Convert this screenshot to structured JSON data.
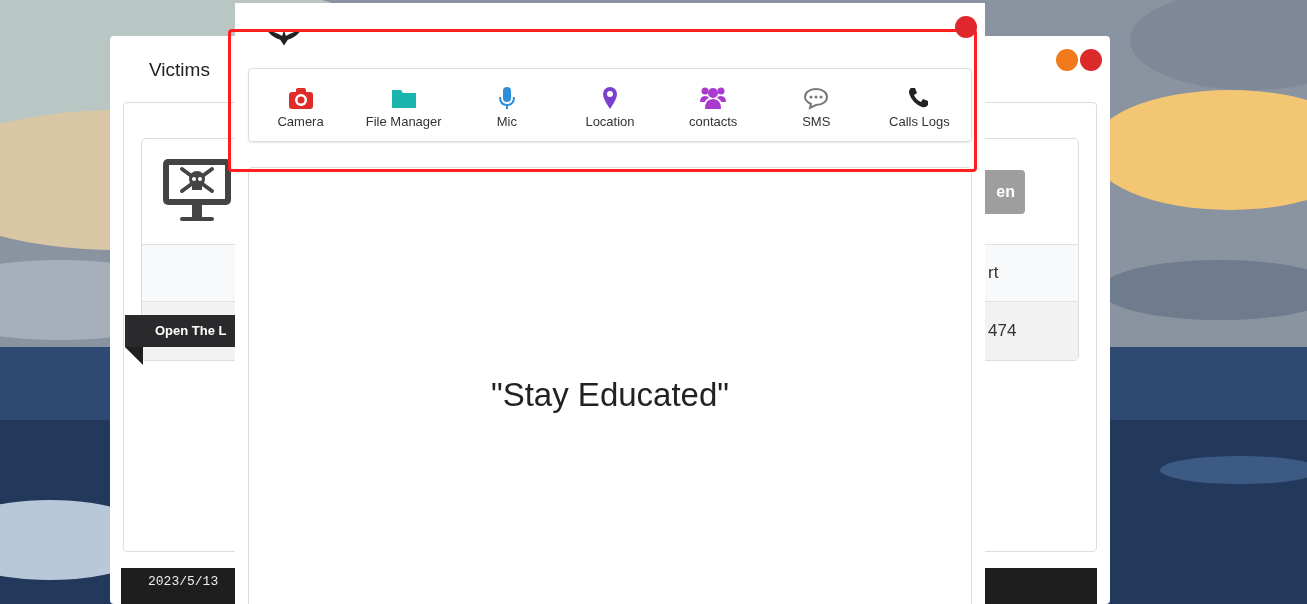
{
  "back_window": {
    "title": "Victims",
    "victim_card": {
      "button": "en",
      "table": {
        "header": "rt",
        "row": "474"
      },
      "ribbon": "Open The L"
    },
    "log_bar": [
      "2023/5/13"
    ]
  },
  "modal": {
    "toolbar": [
      {
        "kind": "camera",
        "label": "Camera",
        "color": "#e02b2b"
      },
      {
        "kind": "folder",
        "label": "File Manager",
        "color": "#1bb5ad"
      },
      {
        "kind": "mic",
        "label": "Mic",
        "color": "#2d8fd9"
      },
      {
        "kind": "pin",
        "label": "Location",
        "color": "#7a3fd1"
      },
      {
        "kind": "users",
        "label": "contacts",
        "color": "#a93ad0"
      },
      {
        "kind": "chat",
        "label": "SMS",
        "color": "#777777"
      },
      {
        "kind": "phone",
        "label": "Calls Logs",
        "color": "#222222"
      }
    ],
    "message": "\"Stay Educated\""
  }
}
